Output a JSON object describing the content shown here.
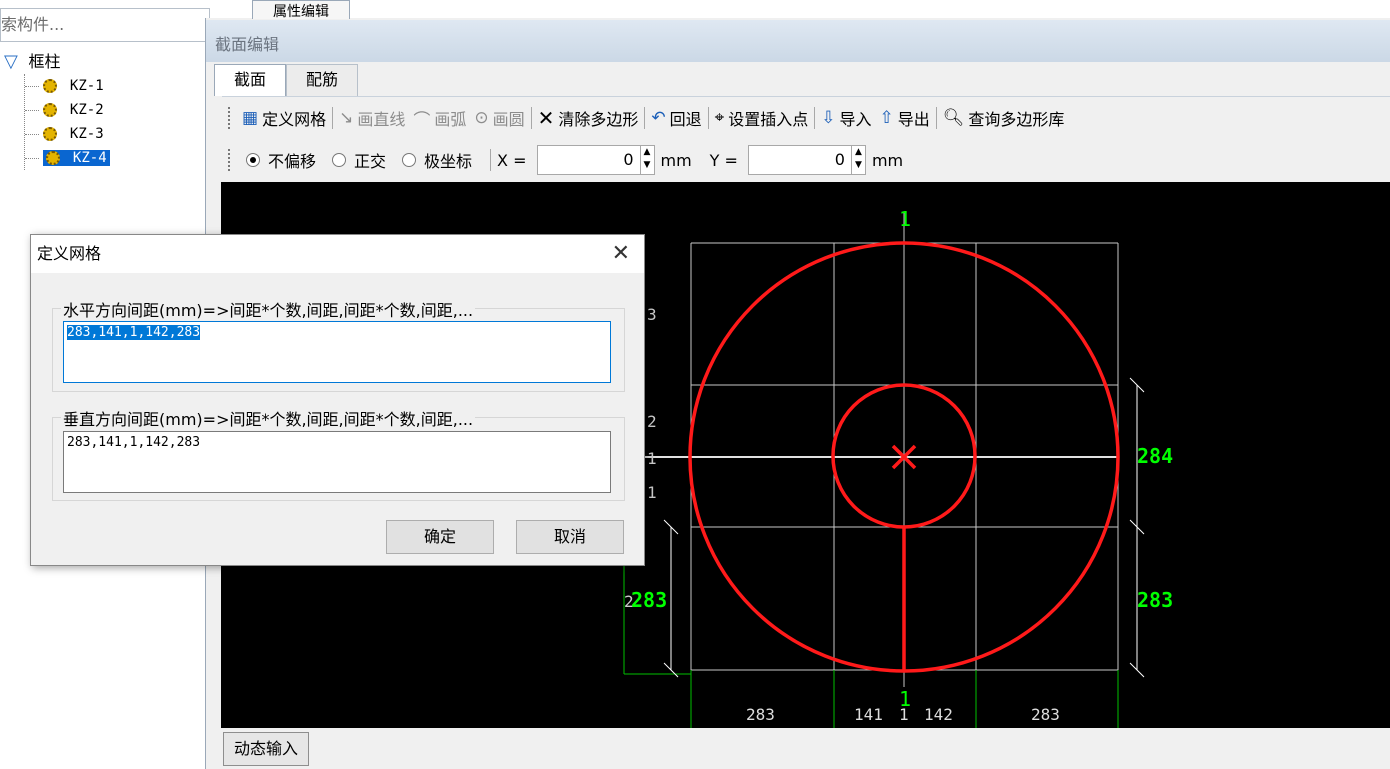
{
  "colors": {
    "canvas_bg": "#000000",
    "shape": "#ff0000",
    "dim_text": "#00ff00",
    "grid": "#c8c8c8",
    "selection": "#0a66d0"
  },
  "left_panel": {
    "search_placeholder": "索构件...",
    "tree": {
      "root_label": "框柱",
      "root_icon": "filter-icon",
      "items": [
        {
          "label": "KZ-1",
          "icon": "gear-icon",
          "selected": false
        },
        {
          "label": "KZ-2",
          "icon": "gear-icon",
          "selected": false
        },
        {
          "label": "KZ-3",
          "icon": "gear-icon",
          "selected": false
        },
        {
          "label": "KZ-4",
          "icon": "gear-icon",
          "selected": true
        }
      ]
    }
  },
  "window": {
    "prop_tab": "属性编辑",
    "title": "截面编辑",
    "tabs": [
      {
        "label": "截面",
        "active": true
      },
      {
        "label": "配筋",
        "active": false
      }
    ]
  },
  "toolbar": {
    "items": [
      {
        "label": "定义网格",
        "icon": "grid-icon",
        "enabled": true
      },
      {
        "label": "画直线",
        "icon": "line-icon",
        "enabled": false
      },
      {
        "label": "画弧",
        "icon": "arc-icon",
        "enabled": false
      },
      {
        "label": "画圆",
        "icon": "circle-icon",
        "enabled": false
      },
      {
        "label": "清除多边形",
        "icon": "close-icon",
        "enabled": true
      },
      {
        "label": "回退",
        "icon": "undo-icon",
        "enabled": true
      },
      {
        "label": "设置插入点",
        "icon": "insert-point-icon",
        "enabled": true
      },
      {
        "label": "导入",
        "icon": "import-icon",
        "enabled": true
      },
      {
        "label": "导出",
        "icon": "export-icon",
        "enabled": true
      },
      {
        "label": "查询多边形库",
        "icon": "search-icon",
        "enabled": true
      }
    ]
  },
  "coords": {
    "modes": [
      {
        "label": "不偏移",
        "checked": true
      },
      {
        "label": "正交",
        "checked": false
      },
      {
        "label": "极坐标",
        "checked": false
      }
    ],
    "x_label": "X =",
    "x_value": "0",
    "x_unit": "mm",
    "y_label": "Y =",
    "y_value": "0",
    "y_unit": "mm"
  },
  "canvas": {
    "bottom_dims": [
      "283",
      "141",
      "1",
      "142",
      "283"
    ],
    "right_dims": [
      "284",
      "283"
    ],
    "left_dim": "283",
    "left_partial_labels": [
      "3",
      "2",
      "1",
      "1",
      "2"
    ],
    "axis_labels": [
      "1",
      "1"
    ]
  },
  "status": {
    "dynamic_input": "动态输入"
  },
  "dialog": {
    "title": "定义网格",
    "horizontal_label": "水平方向间距(mm)=>间距*个数,间距,间距*个数,间距,...",
    "horizontal_value": "283,141,1,142,283",
    "vertical_label": "垂直方向间距(mm)=>间距*个数,间距,间距*个数,间距,...",
    "vertical_value": "283,141,1,142,283",
    "ok_label": "确定",
    "cancel_label": "取消"
  }
}
